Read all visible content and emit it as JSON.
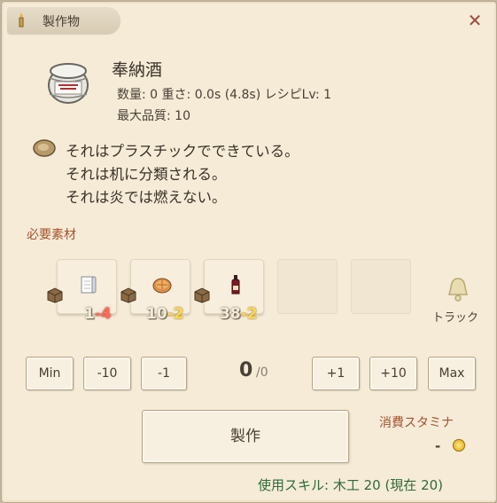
{
  "window": {
    "title": "製作物",
    "close_label": "✕"
  },
  "item": {
    "name": "奉納酒",
    "stats": "数量: 0  重さ: 0.0s (4.8s)  レシピLv: 1",
    "quality": "最大品質: 10"
  },
  "description": [
    "それはプラスチックでできている。",
    "それは机に分類される。",
    "それは炎では燃えない。"
  ],
  "materials": {
    "label": "必要素材",
    "items": [
      {
        "icon": "paper-roll-icon",
        "have": "1",
        "need": "-4",
        "status": "insufficient"
      },
      {
        "icon": "pie-icon",
        "have": "10",
        "need": "-2",
        "status": "ok"
      },
      {
        "icon": "wine-bottle-icon",
        "have": "38",
        "need": "-2",
        "status": "ok"
      }
    ],
    "empty_slots": 2
  },
  "track": {
    "label": "トラック"
  },
  "quantity": {
    "min_label": "Min",
    "minus10_label": "-10",
    "minus1_label": "-1",
    "value": "0",
    "max_value": "/0",
    "plus1_label": "+1",
    "plus10_label": "+10",
    "max_label": "Max"
  },
  "craft": {
    "button_label": "製作"
  },
  "stamina": {
    "label": "消費スタミナ",
    "value": "-"
  },
  "skill": {
    "text": "使用スキル: 木工 20 (現在 20)"
  },
  "colors": {
    "background": "#f5ebd7",
    "accent_label": "#a5532e",
    "skill_text": "#2f6a3a",
    "insufficient": "#ff6a55",
    "sufficient": "#ffd84a"
  }
}
